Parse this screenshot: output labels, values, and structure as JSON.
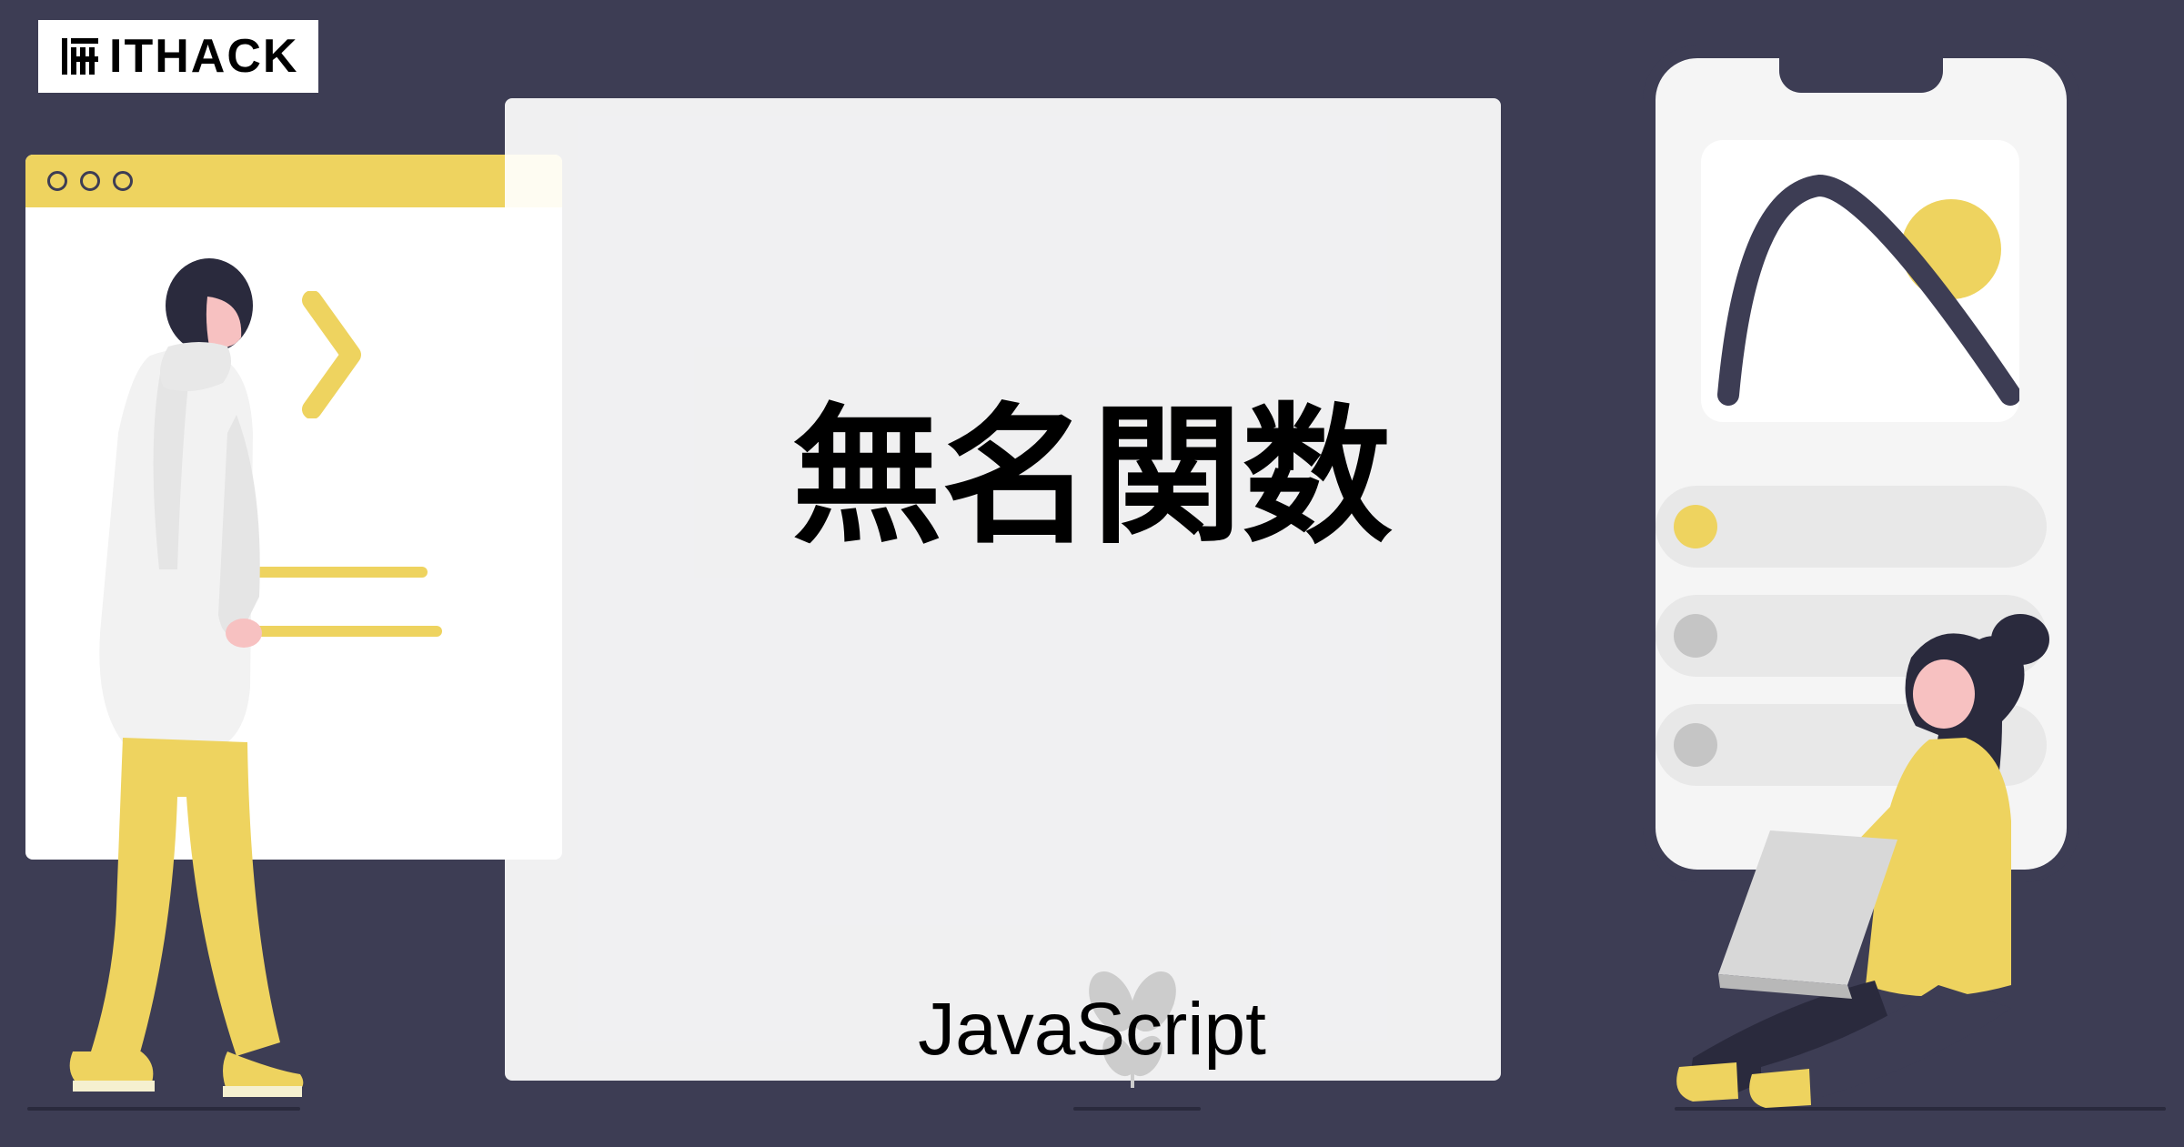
{
  "logo": {
    "text": "ITHACK"
  },
  "main": {
    "title": "無名関数",
    "subtitle": "JavaScript"
  },
  "colors": {
    "background": "#3d3d54",
    "accent": "#eed35f",
    "pink": "#f7c1c1",
    "dark": "#2a2a3d"
  }
}
